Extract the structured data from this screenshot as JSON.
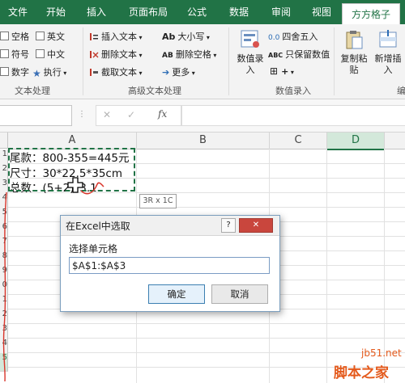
{
  "tabs": [
    "文件",
    "开始",
    "插入",
    "页面布局",
    "公式",
    "数据",
    "审阅",
    "视图",
    "方方格子"
  ],
  "ribbon": {
    "text_group": {
      "items": [
        "空格",
        "英文",
        "符号",
        "中文",
        "数字",
        "执行"
      ],
      "label": "文本处理"
    },
    "advanced_group": {
      "items": [
        "插入文本",
        "大小写",
        "删除文本",
        "删除空格",
        "截取文本",
        "更多"
      ],
      "label": "高级文本处理"
    },
    "number_group": {
      "items": [
        "数值录入",
        "四舍五入",
        "只保留数值"
      ],
      "label": "数值录入"
    },
    "right_group": {
      "items": [
        "复制粘贴",
        "新增插入"
      ],
      "edge_label": "编"
    }
  },
  "formula_bar": {
    "fx": "fx",
    "cancel": "✕",
    "confirm": "✓"
  },
  "grid": {
    "columns": [
      "A",
      "B",
      "C",
      "D"
    ],
    "rows": [
      "1",
      "2",
      "3",
      "4",
      "5",
      "6",
      "7",
      "8",
      "9",
      "0",
      "1",
      "2",
      "3",
      "4",
      "5"
    ],
    "cells": [
      "尾款：800-355=445元",
      "尺寸：30*22.5*35cm",
      "总数：(5+2)*3.1"
    ]
  },
  "tooltip": "3R x 1C",
  "dialog": {
    "title": "在Excel中选取",
    "help": "?",
    "close": "✕",
    "label": "选择单元格",
    "value": "$A$1:$A$3",
    "ok": "确定",
    "cancel": "取消"
  },
  "watermark": {
    "line1": "jb51.net",
    "line2": "脚本之家"
  }
}
